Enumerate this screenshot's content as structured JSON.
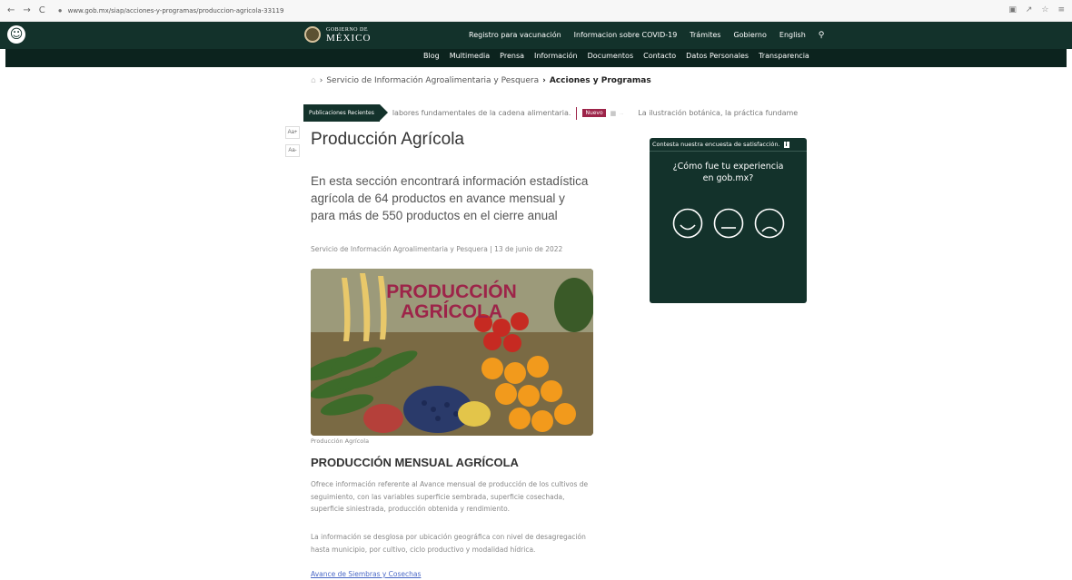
{
  "browser": {
    "url": "www.gob.mx/siap/acciones-y-programas/produccion-agricola-33119",
    "nav_glyphs": [
      "←",
      "→",
      "C"
    ],
    "right_icons": [
      "translate-icon",
      "share-icon",
      "star-icon",
      "menu-icon"
    ]
  },
  "header": {
    "logo_small": "GOBIERNO DE",
    "logo_big": "MÉXICO",
    "main_nav": [
      "Registro para vacunación",
      "Informacion sobre COVID-19",
      "Trámites",
      "Gobierno",
      "English"
    ],
    "sub_nav": [
      "Blog",
      "Multimedia",
      "Prensa",
      "Información",
      "Documentos",
      "Contacto",
      "Datos Personales",
      "Transparencia"
    ]
  },
  "breadcrumb": {
    "parent": "Servicio de Información Agroalimentaria y Pesquera",
    "current": "Acciones y Programas"
  },
  "ticker": {
    "label": "Publicaciones Recientes",
    "item1": "labores fundamentales de la cadena alimentaria.",
    "badge": "Nuevo",
    "item2": "La ilustración botánica, la práctica fundame"
  },
  "font_controls": {
    "increase": "Aa+",
    "decrease": "Aa-"
  },
  "article": {
    "title": "Producción Agrícola",
    "intro": "En esta sección encontrará información estadística agrícola de 64 productos en avance mensual y para más de 550 productos en el cierre anual",
    "meta": "Servicio de Información Agroalimentaria y Pesquera | 13 de junio de 2022",
    "image_text_1": "PRODUCCIÓN",
    "image_text_2": "AGRÍCOLA",
    "caption": "Producción Agrícola",
    "section_title": "PRODUCCIÓN MENSUAL AGRÍCOLA",
    "para1": "Ofrece información referente al Avance mensual de producción de los cultivos de seguimiento, con las variables superficie sembrada, superficie cosechada, superficie siniestrada, producción obtenida y rendimiento.",
    "para2": "La información se desglosa por ubicación geográfica con nivel de desagregación hasta municipio, por cultivo, ciclo productivo y modalidad hídrica.",
    "link": "Avance de Siembras y Cosechas"
  },
  "survey": {
    "header": "Contesta nuestra encuesta de satisfacción.",
    "question": "¿Cómo fue tu experiencia en gob.mx?",
    "faces": [
      "happy-face-icon",
      "neutral-face-icon",
      "sad-face-icon"
    ]
  },
  "colors": {
    "header_green": "#13322b",
    "subnav_green": "#0c231e",
    "accent_red": "#9d2449",
    "link_blue": "#4a68c6"
  }
}
